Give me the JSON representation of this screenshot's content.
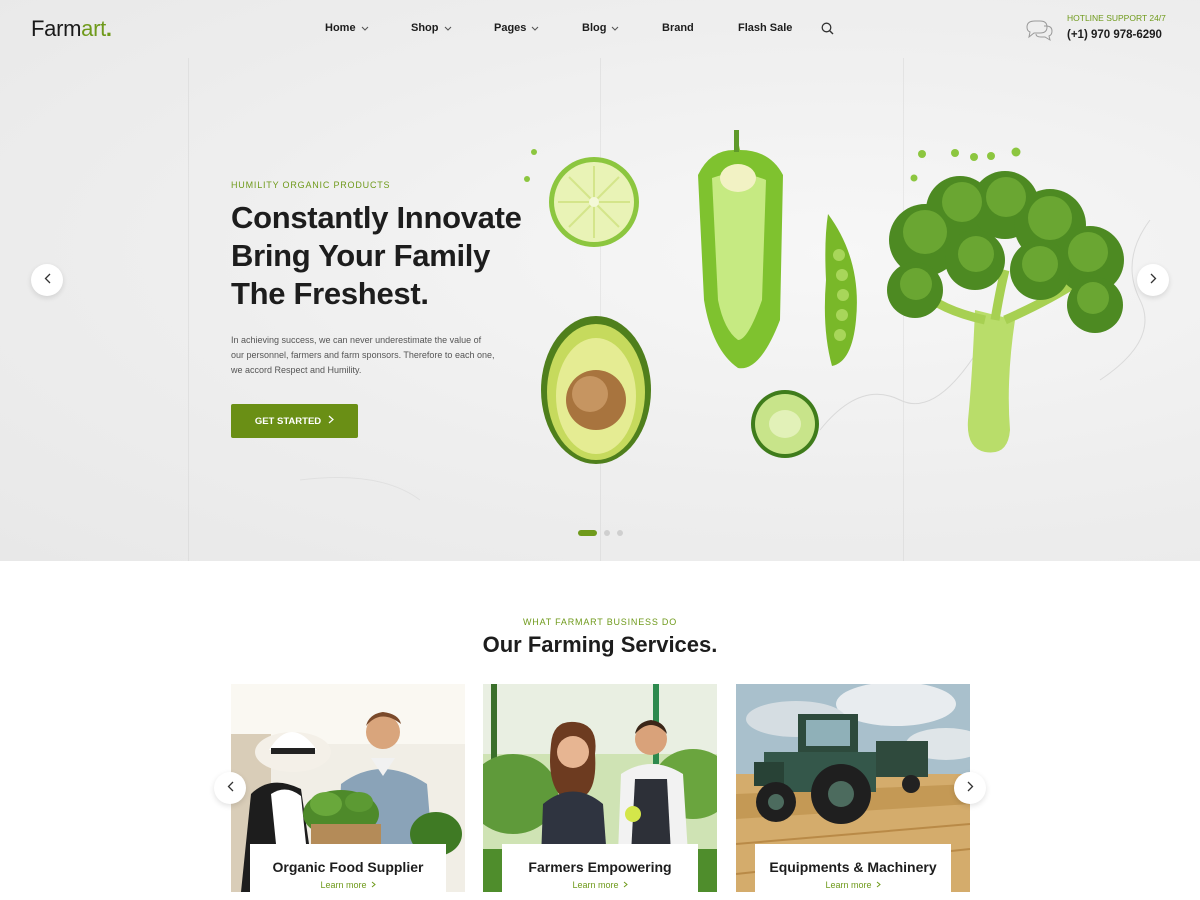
{
  "brand": {
    "logo_main": "Farm",
    "logo_accent": "art",
    "logo_dot": "."
  },
  "nav": {
    "items": [
      {
        "label": "Home",
        "dropdown": true
      },
      {
        "label": "Shop",
        "dropdown": true
      },
      {
        "label": "Pages",
        "dropdown": true
      },
      {
        "label": "Blog",
        "dropdown": true
      },
      {
        "label": "Brand",
        "dropdown": false
      },
      {
        "label": "Flash Sale",
        "dropdown": false
      }
    ],
    "search_icon": "search-icon"
  },
  "hotline": {
    "icon": "chat-bubbles-icon",
    "label": "HOTLINE SUPPORT 24/7",
    "number": "(+1) 970 978-6290"
  },
  "hero": {
    "kicker": "HUMILITY ORGANIC PRODUCTS",
    "title_lines": [
      "Constantly Innovate",
      "Bring Your Family",
      "The Freshest."
    ],
    "text": "In achieving success, we can never underestimate the value of our personnel, farmers and farm sponsors. Therefore to each one, we accord Respect and Humility.",
    "cta_label": "GET STARTED",
    "cta_icon": "chevron-right-icon",
    "prev_icon": "chevron-left-icon",
    "next_icon": "chevron-right-icon",
    "slides_total": 3,
    "active_slide": 1
  },
  "services": {
    "kicker": "WHAT FARMART BUSINESS DO",
    "title": "Our Farming Services.",
    "cards": [
      {
        "title": "Organic Food Supplier",
        "link": "Learn more"
      },
      {
        "title": "Farmers Empowering",
        "link": "Learn more"
      },
      {
        "title": "Equipments & Machinery",
        "link": "Learn more"
      }
    ],
    "prev_icon": "chevron-left-icon",
    "next_icon": "chevron-right-icon"
  },
  "colors": {
    "accent": "#6f9a1b",
    "button": "#6a8f15",
    "text": "#1d1d1d"
  }
}
